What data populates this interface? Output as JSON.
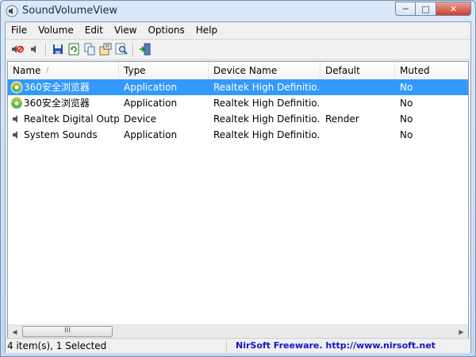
{
  "window": {
    "title": "SoundVolumeView",
    "minimize": "─",
    "maximize": "□",
    "close": "✕"
  },
  "menu": [
    "File",
    "Volume",
    "Edit",
    "View",
    "Options",
    "Help"
  ],
  "toolbar": {
    "buttons": [
      "mute-icon",
      "speaker-icon",
      "save-icon",
      "refresh-icon",
      "copy-icon",
      "properties-icon",
      "find-icon",
      "exit-icon"
    ]
  },
  "table": {
    "columns": [
      "Name",
      "Type",
      "Device Name",
      "Default",
      "Muted"
    ],
    "sort_indicator": "/",
    "rows": [
      {
        "name": "360安全浏览器",
        "type": "Application",
        "device": "Realtek High Definitio...",
        "default": "",
        "muted": "No",
        "icon": "browser-360-icon",
        "selected": true
      },
      {
        "name": "360安全浏览器",
        "type": "Application",
        "device": "Realtek High Definitio...",
        "default": "",
        "muted": "No",
        "icon": "browser-360-icon",
        "selected": false
      },
      {
        "name": "Realtek Digital Outp...",
        "type": "Device",
        "device": "Realtek High Definitio...",
        "default": "Render",
        "muted": "No",
        "icon": "speaker-icon",
        "selected": false
      },
      {
        "name": "System Sounds",
        "type": "Application",
        "device": "Realtek High Definitio...",
        "default": "",
        "muted": "No",
        "icon": "speaker-icon",
        "selected": false
      }
    ]
  },
  "scrollbar": {
    "left_arrow": "◀",
    "right_arrow": "▶",
    "thumb_grip": "III"
  },
  "status": {
    "count": "4 item(s), 1 Selected",
    "credit": "NirSoft Freeware.  http://www.nirsoft.net"
  },
  "colors": {
    "selection": "#3399ff",
    "link": "#1414c8",
    "close_button": "#c7412d"
  }
}
